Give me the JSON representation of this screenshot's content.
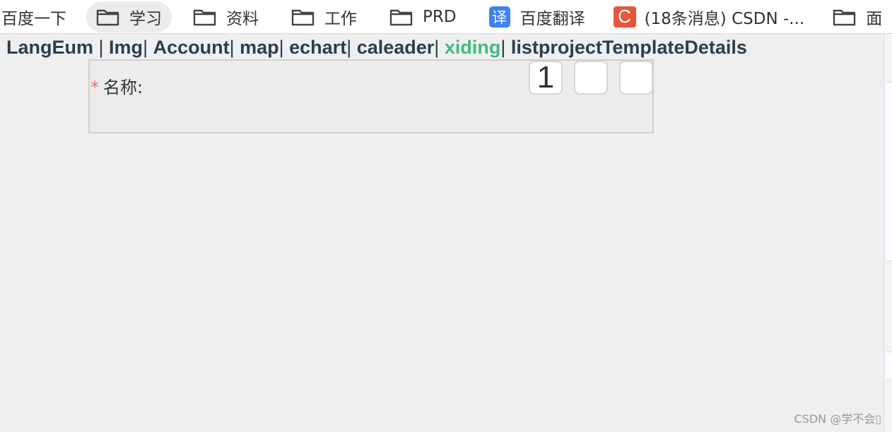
{
  "bookmarks": [
    {
      "label": "百度一下",
      "icon": "none"
    },
    {
      "label": "学习",
      "icon": "folder-icon"
    },
    {
      "label": "资料",
      "icon": "folder-icon"
    },
    {
      "label": "工作",
      "icon": "folder-icon"
    },
    {
      "label": "PRD",
      "icon": "folder-icon"
    },
    {
      "label": "百度翻译",
      "icon": "baidu-translate-icon",
      "icon_glyph": "译"
    },
    {
      "label": "(18条消息) CSDN -...",
      "icon": "csdn-icon",
      "icon_glyph": "C"
    },
    {
      "label": "面",
      "icon": "folder-icon"
    }
  ],
  "nav": {
    "items": [
      "LangEum",
      "Img",
      "Account",
      "map",
      "echart",
      "caleader",
      "xiding",
      "listprojectTemplateDetails"
    ],
    "active": "xiding"
  },
  "form": {
    "required_mark": "*",
    "name_label": "名称:",
    "code_values": [
      "1",
      "",
      ""
    ]
  },
  "watermark": "CSDN @学不会▯",
  "colors": {
    "nav_text": "#2c3e50",
    "nav_active": "#42b983",
    "required": "#f56c6c",
    "translate_icon_bg": "#3b82f6",
    "csdn_icon_bg": "#e8553a"
  }
}
